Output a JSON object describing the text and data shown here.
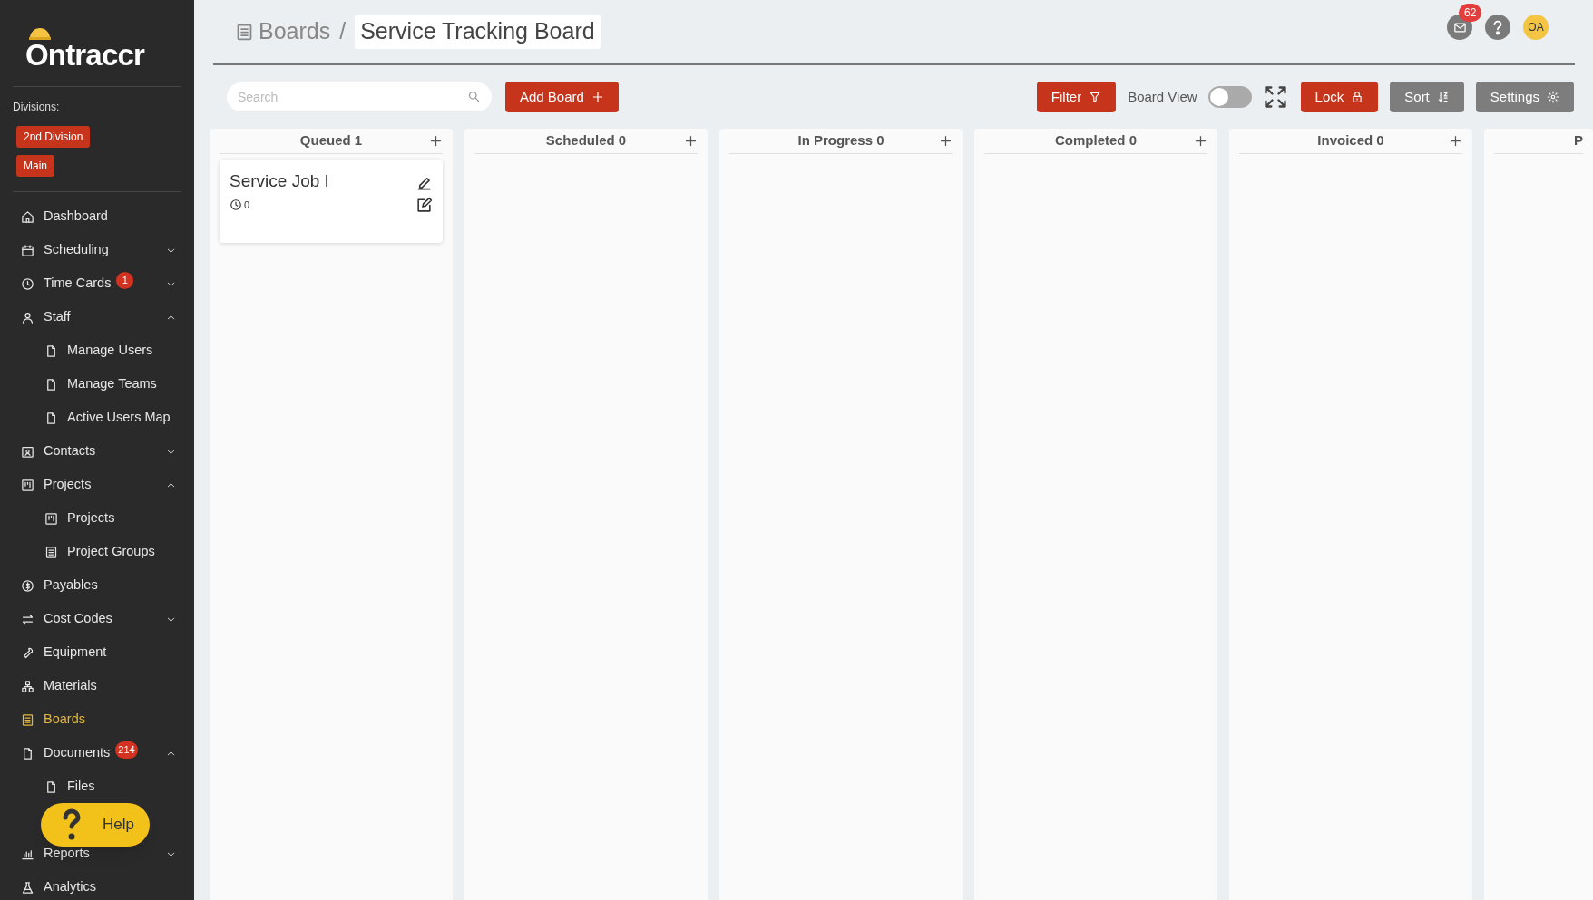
{
  "sidebar": {
    "logo": "Ontraccr",
    "divisions_label": "Divisions:",
    "divisions": [
      "2nd Division",
      "Main"
    ],
    "nav": [
      {
        "label": "Dashboard",
        "selected": false
      },
      {
        "label": "Scheduling",
        "selected": false,
        "expanded": false
      },
      {
        "label": "Time Cards",
        "selected": false,
        "expanded": false,
        "badge": "1"
      },
      {
        "label": "Staff",
        "selected": false,
        "expanded": true,
        "children": [
          {
            "label": "Manage Users",
            "selected": false
          },
          {
            "label": "Manage Teams",
            "selected": false
          },
          {
            "label": "Active Users Map",
            "selected": false
          }
        ]
      },
      {
        "label": "Contacts",
        "selected": false,
        "expanded": false
      },
      {
        "label": "Projects",
        "selected": false,
        "expanded": true,
        "children": [
          {
            "label": "Projects",
            "selected": false
          },
          {
            "label": "Project Groups",
            "selected": false
          }
        ]
      },
      {
        "label": "Payables",
        "selected": false
      },
      {
        "label": "Cost Codes",
        "selected": false,
        "expanded": false
      },
      {
        "label": "Equipment",
        "selected": false
      },
      {
        "label": "Materials",
        "selected": false
      },
      {
        "label": "Boards",
        "selected": true
      },
      {
        "label": "Documents",
        "selected": false,
        "expanded": true,
        "badge": "214",
        "children": [
          {
            "label": "Files",
            "selected": false
          }
        ]
      },
      {
        "label": "Reports",
        "selected": false,
        "expanded": false
      },
      {
        "label": "Analytics",
        "selected": false
      }
    ],
    "help_button": "Help"
  },
  "header": {
    "breadcrumb": "Boards",
    "separator": "/",
    "title": "Service Tracking Board",
    "notifications": "62",
    "avatar": "OA"
  },
  "toolbar": {
    "search": {
      "placeholder": "Search"
    },
    "add_button": "Add Board",
    "filter_button": "Filter",
    "board_view": {
      "label": "Board View",
      "on": false
    },
    "lock_button": "Lock",
    "sort_button": "Sort",
    "settings_button": "Settings"
  },
  "columns": [
    {
      "title": "Queued 1",
      "cards": [
        {
          "title": "Service Job I",
          "count": "0"
        }
      ]
    },
    {
      "title": "Scheduled 0"
    },
    {
      "title": "In Progress 0"
    },
    {
      "title": "Completed 0"
    },
    {
      "title": "Invoiced 0"
    },
    {
      "title": "P"
    }
  ]
}
